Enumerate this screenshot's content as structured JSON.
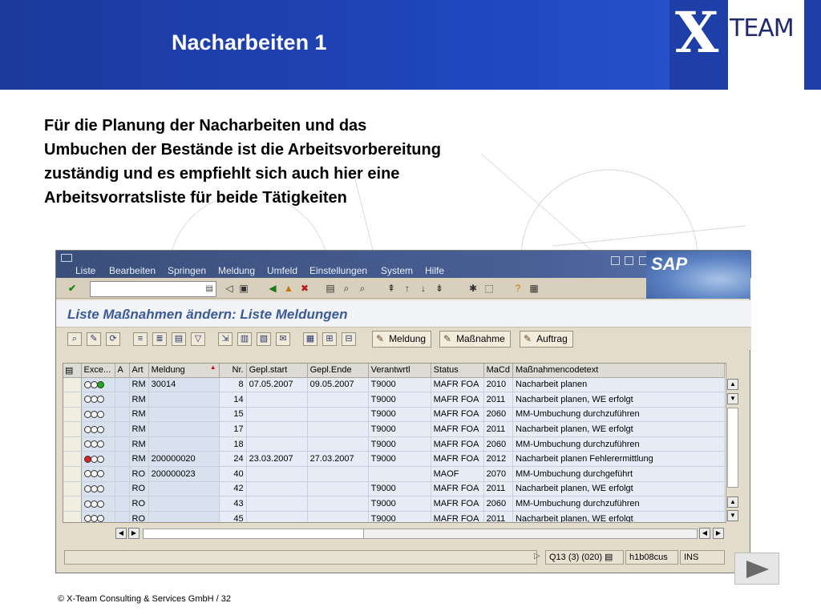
{
  "slide": {
    "title": "Nacharbeiten 1",
    "logo_x": "X",
    "logo_team": "TEAM",
    "body_line1": "Für die Planung der Nacharbeiten und das",
    "body_line2": "Umbuchen der Bestände ist die Arbeitsvorbereitung",
    "body_line3": "zuständig und es empfiehlt sich auch hier eine",
    "body_line4": "Arbeitsvorratsliste für beide Tätigkeiten",
    "footer": "©  X-Team Consulting & Services GmbH  / 32"
  },
  "sap": {
    "menu": [
      "Liste",
      "Bearbeiten",
      "Springen",
      "Meldung",
      "Umfeld",
      "Einstellungen",
      "System",
      "Hilfe"
    ],
    "logo_text": "SAP",
    "screen_title": "Liste Maßnahmen ändern: Liste Meldungen",
    "buttons": {
      "meldung": "Meldung",
      "massnahme": "Maßnahme",
      "auftrag": "Auftrag"
    },
    "columns": [
      "Exce...",
      "A",
      "Art",
      "Meldung",
      "Nr.",
      "Gepl.start",
      "Gepl.Ende",
      "Verantwrtl",
      "Status",
      "MaCd",
      "Maßnahmencodetext"
    ],
    "rows": [
      {
        "lights": "green",
        "a": "",
        "art": "RM",
        "meldung": "30014",
        "nr": "8",
        "start": "07.05.2007",
        "ende": "09.05.2007",
        "verant": "T9000",
        "status": "MAFR FOA",
        "macd": "2010",
        "text": "Nacharbeit planen"
      },
      {
        "lights": "none",
        "a": "",
        "art": "RM",
        "meldung": "",
        "nr": "14",
        "start": "",
        "ende": "",
        "verant": "T9000",
        "status": "MAFR FOA",
        "macd": "2011",
        "text": "Nacharbeit planen, WE erfolgt"
      },
      {
        "lights": "none",
        "a": "",
        "art": "RM",
        "meldung": "",
        "nr": "15",
        "start": "",
        "ende": "",
        "verant": "T9000",
        "status": "MAFR FOA",
        "macd": "2060",
        "text": "MM-Umbuchung durchzuführen"
      },
      {
        "lights": "none",
        "a": "",
        "art": "RM",
        "meldung": "",
        "nr": "17",
        "start": "",
        "ende": "",
        "verant": "T9000",
        "status": "MAFR FOA",
        "macd": "2011",
        "text": "Nacharbeit planen, WE erfolgt"
      },
      {
        "lights": "none",
        "a": "",
        "art": "RM",
        "meldung": "",
        "nr": "18",
        "start": "",
        "ende": "",
        "verant": "T9000",
        "status": "MAFR FOA",
        "macd": "2060",
        "text": "MM-Umbuchung durchzuführen"
      },
      {
        "lights": "red",
        "a": "",
        "art": "RM",
        "meldung": "200000020",
        "nr": "24",
        "start": "23.03.2007",
        "ende": "27.03.2007",
        "verant": "T9000",
        "status": "MAFR FOA",
        "macd": "2012",
        "text": "Nacharbeit planen Fehlerermittlung"
      },
      {
        "lights": "none",
        "a": "",
        "art": "RO",
        "meldung": "200000023",
        "nr": "40",
        "start": "",
        "ende": "",
        "verant": "",
        "status": "MAOF",
        "macd": "2070",
        "text": "MM-Umbuchung durchgeführt"
      },
      {
        "lights": "none",
        "a": "",
        "art": "RO",
        "meldung": "",
        "nr": "42",
        "start": "",
        "ende": "",
        "verant": "T9000",
        "status": "MAFR FOA",
        "macd": "2011",
        "text": "Nacharbeit planen, WE erfolgt"
      },
      {
        "lights": "none",
        "a": "",
        "art": "RO",
        "meldung": "",
        "nr": "43",
        "start": "",
        "ende": "",
        "verant": "T9000",
        "status": "MAFR FOA",
        "macd": "2060",
        "text": "MM-Umbuchung durchzuführen"
      },
      {
        "lights": "none",
        "a": "",
        "art": "RO",
        "meldung": "",
        "nr": "45",
        "start": "",
        "ende": "",
        "verant": "T9000",
        "status": "MAFR FOA",
        "macd": "2011",
        "text": "Nacharbeit planen, WE erfolgt"
      }
    ],
    "status": {
      "session": "Q13 (3) (020)",
      "server": "h1b08cus",
      "mode": "INS"
    }
  },
  "colors": {
    "header_blue": "#1e44b8",
    "sap_title": "#3a5a9a",
    "row_bg": "#e6edf7"
  }
}
